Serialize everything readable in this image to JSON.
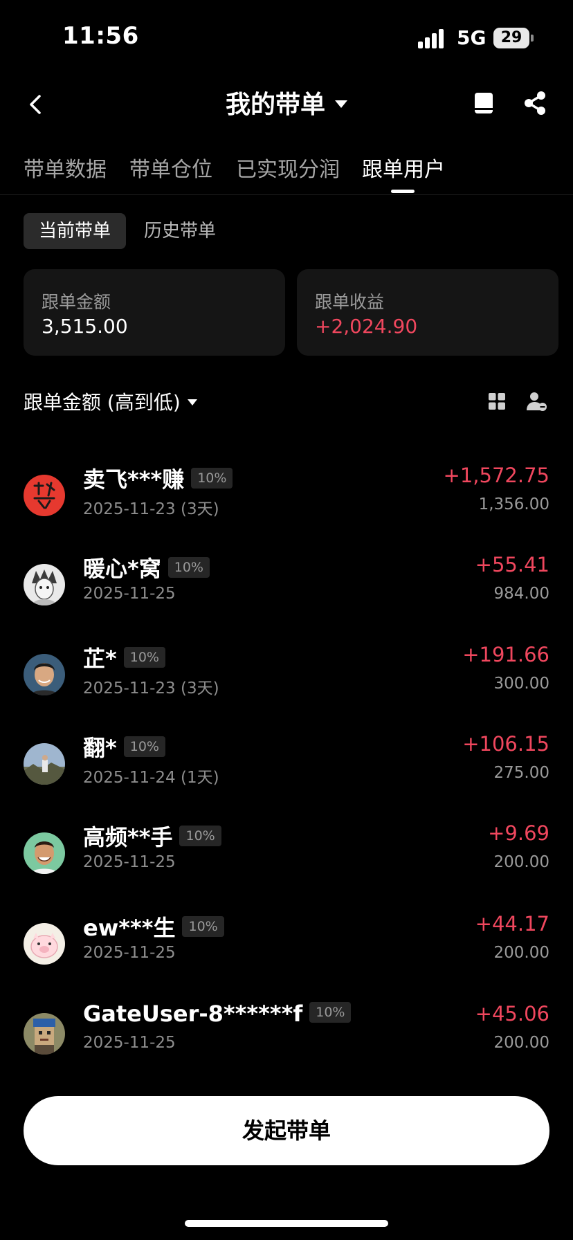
{
  "status_bar": {
    "time": "11:56",
    "network": "5G",
    "battery": "29"
  },
  "nav": {
    "title": "我的带单"
  },
  "tabs": [
    {
      "label": "带单数据",
      "active": false
    },
    {
      "label": "带单仓位",
      "active": false
    },
    {
      "label": "已实现分润",
      "active": false
    },
    {
      "label": "跟单用户",
      "active": true
    }
  ],
  "subtabs": [
    {
      "label": "当前带单",
      "active": true
    },
    {
      "label": "历史带单",
      "active": false
    }
  ],
  "summary": {
    "amount_label": "跟单金额",
    "amount_value": "3,515.00",
    "profit_label": "跟单收益",
    "profit_value": "+2,024.90"
  },
  "sort": {
    "label": "跟单金额 (高到低)"
  },
  "followers": [
    {
      "name": "卖飞***赚",
      "share": "10%",
      "date": "2025-11-23 (3天)",
      "profit": "+1,572.75",
      "amount": "1,356.00",
      "avatar": "calligraphy-red-avatar"
    },
    {
      "name": "暖心*窝",
      "share": "10%",
      "date": "2025-11-25",
      "profit": "+55.41",
      "amount": "984.00",
      "avatar": "anime-sketch-avatar"
    },
    {
      "name": "芷*",
      "share": "10%",
      "date": "2025-11-23 (3天)",
      "profit": "+191.66",
      "amount": "300.00",
      "avatar": "portrait-avatar"
    },
    {
      "name": "翻*",
      "share": "10%",
      "date": "2025-11-24 (1天)",
      "profit": "+106.15",
      "amount": "275.00",
      "avatar": "landscape-avatar"
    },
    {
      "name": "高频**手",
      "share": "10%",
      "date": "2025-11-25",
      "profit": "+9.69",
      "amount": "200.00",
      "avatar": "smiling-man-avatar"
    },
    {
      "name": "ew***生",
      "share": "10%",
      "date": "2025-11-25",
      "profit": "+44.17",
      "amount": "200.00",
      "avatar": "cartoon-pig-avatar"
    },
    {
      "name": "GateUser-8******f",
      "share": "10%",
      "date": "2025-11-25",
      "profit": "+45.06",
      "amount": "200.00",
      "avatar": "pixel-punk-avatar"
    }
  ],
  "launch_button": "发起带单",
  "colors": {
    "background": "#000000",
    "card": "#151515",
    "profit_red": "#f0475e",
    "muted": "#9a9a9a"
  }
}
